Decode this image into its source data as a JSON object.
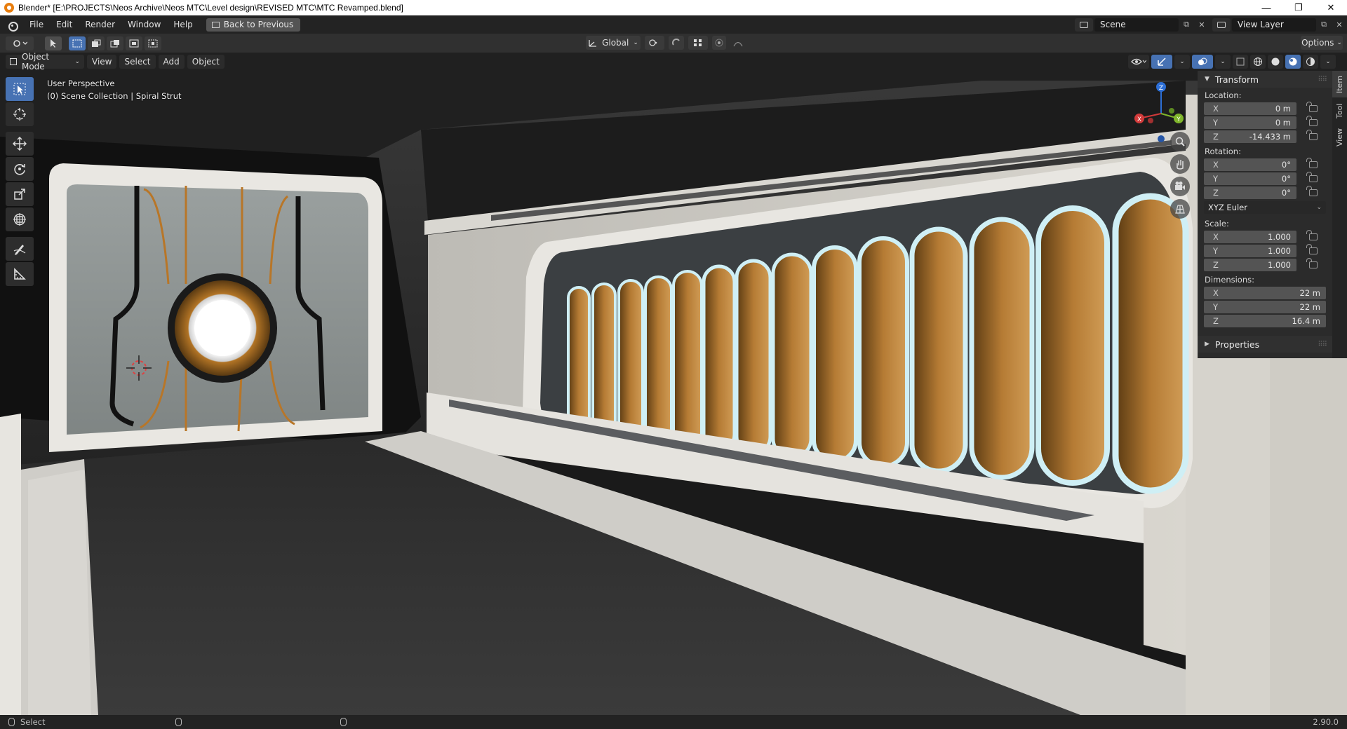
{
  "window": {
    "title": "Blender* [E:\\PROJECTS\\Neos Archive\\Neos MTC\\Level design\\REVISED MTC\\MTC Revamped.blend]",
    "minimize": "—",
    "maximize": "❐",
    "close": "✕"
  },
  "menubar": {
    "items": [
      "File",
      "Edit",
      "Render",
      "Window",
      "Help"
    ],
    "back_button": "Back to Previous",
    "scene": "Scene",
    "view_layer": "View Layer"
  },
  "header": {
    "transform_orientation": "Global",
    "options": "Options"
  },
  "viewport_header": {
    "mode": "Object Mode",
    "menus": [
      "View",
      "Select",
      "Add",
      "Object"
    ]
  },
  "viewport": {
    "perspective": "User Perspective",
    "collection": "(0) Scene Collection | Spiral Strut"
  },
  "gizmo": {
    "x": "X",
    "y": "Y",
    "z": "Z"
  },
  "npanel": {
    "transform_header": "Transform",
    "location_label": "Location:",
    "location": [
      {
        "axis": "X",
        "value": "0 m"
      },
      {
        "axis": "Y",
        "value": "0 m"
      },
      {
        "axis": "Z",
        "value": "-14.433 m"
      }
    ],
    "rotation_label": "Rotation:",
    "rotation": [
      {
        "axis": "X",
        "value": "0°"
      },
      {
        "axis": "Y",
        "value": "0°"
      },
      {
        "axis": "Z",
        "value": "0°"
      }
    ],
    "rotation_mode": "XYZ Euler",
    "scale_label": "Scale:",
    "scale": [
      {
        "axis": "X",
        "value": "1.000"
      },
      {
        "axis": "Y",
        "value": "1.000"
      },
      {
        "axis": "Z",
        "value": "1.000"
      }
    ],
    "dimensions_label": "Dimensions:",
    "dimensions": [
      {
        "axis": "X",
        "value": "22 m"
      },
      {
        "axis": "Y",
        "value": "22 m"
      },
      {
        "axis": "Z",
        "value": "16.4 m"
      }
    ],
    "properties_header": "Properties"
  },
  "sidetabs": [
    "Item",
    "Tool",
    "View"
  ],
  "statusbar": {
    "select": "Select",
    "version": "2.90.0"
  }
}
